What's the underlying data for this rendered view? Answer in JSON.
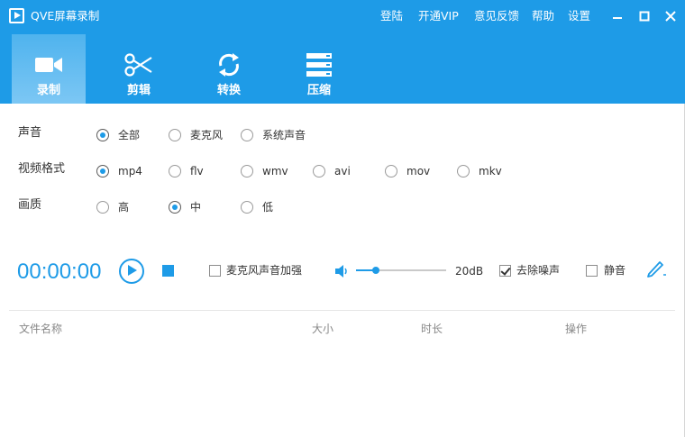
{
  "titlebar": {
    "title": "QVE屏幕录制",
    "menu": [
      "登陆",
      "开通VIP",
      "意见反馈",
      "帮助",
      "设置"
    ]
  },
  "toolbar": {
    "tabs": [
      {
        "label": "录制",
        "icon": "video-camera-icon",
        "active": true
      },
      {
        "label": "剪辑",
        "icon": "scissors-icon",
        "active": false
      },
      {
        "label": "转换",
        "icon": "convert-icon",
        "active": false
      },
      {
        "label": "压缩",
        "icon": "compress-icon",
        "active": false
      }
    ]
  },
  "options": {
    "sound": {
      "label": "声音",
      "choices": [
        "全部",
        "麦克风",
        "系统声音"
      ],
      "selected": "全部"
    },
    "format": {
      "label": "视频格式",
      "choices": [
        "mp4",
        "flv",
        "wmv",
        "avi",
        "mov",
        "mkv"
      ],
      "selected": "mp4"
    },
    "quality": {
      "label": "画质",
      "choices": [
        "高",
        "中",
        "低"
      ],
      "selected": "中"
    }
  },
  "recorder": {
    "time": "00:00:00",
    "mic_boost_label": "麦克风声音加强",
    "mic_boost_checked": false,
    "volume_fraction": 0.22,
    "volume_text": "20dB",
    "denoise_label": "去除噪声",
    "denoise_checked": true,
    "mute_label": "静音",
    "mute_checked": false
  },
  "file_table": {
    "columns": [
      "文件名称",
      "大小",
      "时长",
      "操作"
    ],
    "rows": []
  },
  "colors": {
    "accent": "#1e9be7",
    "tab_active": "#5cb8ef"
  }
}
